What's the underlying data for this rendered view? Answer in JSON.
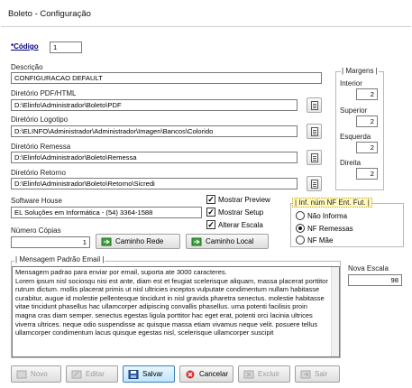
{
  "window": {
    "title": "Boleto - Configuração"
  },
  "codigo": {
    "label": "*Código",
    "value": "1"
  },
  "descricao": {
    "label": "Descrição",
    "value": "CONFIGURACAO DEFAULT"
  },
  "pdf": {
    "label": "Diretório PDF/HTML",
    "value": "D:\\Elinfo\\Administrador\\Boleto\\PDF"
  },
  "logotipo": {
    "label": "Diretório Logotipo",
    "value": "D:\\ELINFO\\Administrador\\Administrador\\Imagen\\Bancos\\Colorido"
  },
  "remessa": {
    "label": "Diretório Remessa",
    "value": "D:\\Elinfo\\Administrador\\Boleto\\Remessa"
  },
  "retorno": {
    "label": "Diretório Retorno",
    "value": "D:\\Elinfo\\Administrador\\Boleto\\Retorno\\Sicredi"
  },
  "margens": {
    "title": "Margens",
    "interior": {
      "label": "Interior",
      "value": "2"
    },
    "superior": {
      "label": "Superior",
      "value": "2"
    },
    "esquerda": {
      "label": "Esquerda",
      "value": "2"
    },
    "direita": {
      "label": "Direita",
      "value": "2"
    }
  },
  "software": {
    "label": "Software House",
    "value": "EL Soluções em Informática - (54) 3364-1588"
  },
  "options": {
    "preview": "Mostrar Preview",
    "setup": "Mostrar Setup",
    "escala": "Alterar Escala"
  },
  "nf": {
    "title": "Inf. núm NF Ent. Fut.",
    "options": [
      "Não Informa",
      "NF Remessas",
      "NF Mãe"
    ],
    "selected": "NF Remessas"
  },
  "copias": {
    "label": "Número Cópias",
    "value": "1"
  },
  "buttons": {
    "caminho_rede": "Caminho Rede",
    "caminho_local": "Caminho Local",
    "novo": "Novo",
    "editar": "Editar",
    "salvar": "Salvar",
    "cancelar": "Cancelar",
    "excluir": "Excluir",
    "sair": "Sair"
  },
  "email": {
    "title": "Mensagem Padrão Email",
    "text": "Mensagem padrao para enviar por email, suporta ate 3000 caracteres.\nLorem ipsum nisl sociosqu nisi est ante, diam est et feugiat scelerisque aliquam, massa placerat porttitor rutrum dictum. mollis placerat primis ut nisl ultricies inceptos vulputate condimentum nullam habitasse curabitur, augue id molestie pellentesque tincidunt in nisl gravida pharetra senectus. molestie habitasse vitae tincidunt phasellus hac ullamcorper adipiscing convallis phasellus. urna potenti facilisis proin magna cras diam semper. senectus egestas ligula porttitor hac eget erat, potenti orci lacinia ultrices viverra ultrices. neque odio suspendisse ac quisque massa etiam vivamus neque velit. posuere tellus ullamcorper condimentum lacus quisque egestas nisl, scelerisque ullamcorper suscipit"
  },
  "nova_escala": {
    "label": "Nova Escala",
    "value": "98"
  }
}
